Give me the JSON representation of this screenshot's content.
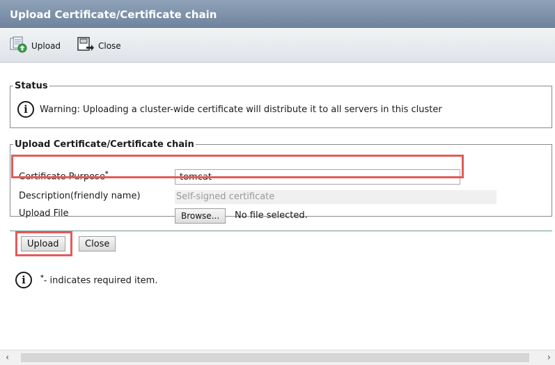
{
  "window": {
    "title": "Upload Certificate/Certificate chain"
  },
  "toolbar": {
    "upload_label": "Upload",
    "close_label": "Close",
    "upload_icon": "upload-icon",
    "close_icon": "close-icon"
  },
  "status": {
    "legend": "Status",
    "message": "Warning: Uploading a cluster-wide certificate will distribute it to all servers in this cluster",
    "icon": "info-icon"
  },
  "upload_section": {
    "legend": "Upload Certificate/Certificate chain",
    "purpose_label": "Certificate Purpose",
    "required_marker": "*",
    "purpose_value": "tomcat",
    "description_label": "Description(friendly name)",
    "description_value": "Self-signed certificate",
    "file_label": "Upload File",
    "browse_label": "Browse...",
    "file_status": "No file selected."
  },
  "actions": {
    "upload_label": "Upload",
    "close_label": "Close"
  },
  "footer_note": {
    "required_marker": "*",
    "text": "- indicates required item."
  },
  "colors": {
    "highlight": "#e35a5a",
    "title_bar": "#7b8fa7"
  }
}
